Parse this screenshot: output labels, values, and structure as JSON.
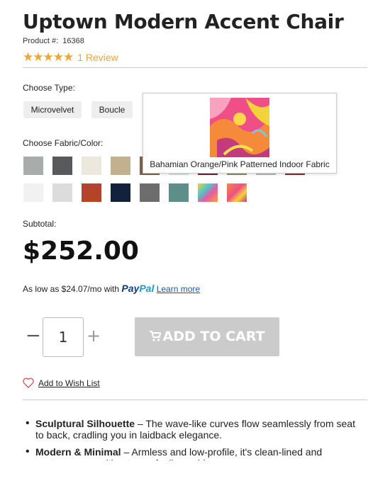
{
  "product": {
    "title": "Uptown Modern Accent Chair",
    "product_number_label": "Product #:",
    "product_number": "16368",
    "stars": "★★★★★",
    "review_text": "1 Review"
  },
  "type": {
    "label": "Choose Type:",
    "options": [
      "Microvelvet",
      "Boucle"
    ]
  },
  "fabric": {
    "label": "Choose Fabric/Color:",
    "row1_colors": [
      "#a8adab",
      "#58595b",
      "#ece8de",
      "#c2b08e",
      "#7a6252",
      "#d6e1e2",
      "#6d2233",
      "#8a8a6e",
      "#b9b8b6",
      "#8e2b2e"
    ],
    "row2_colors": [
      "#f1f1f1",
      "#dcdcdc",
      "#b5432a",
      "#13213a",
      "#6d6d6d",
      "#5e8e8a"
    ],
    "tooltip_label": "Bahamian Orange/Pink Patterned Indoor Fabric",
    "selected_index": 8
  },
  "subtotal": {
    "label": "Subtotal:",
    "price": "$252.00"
  },
  "paypal": {
    "text": "As low as $24.07/mo with",
    "brand_pay": "Pay",
    "brand_pal": "Pal",
    "learn_more": "Learn more"
  },
  "cart": {
    "minus": "−",
    "quantity": "1",
    "plus": "+",
    "button_label": "ADD TO CART"
  },
  "wishlist": {
    "label": "Add to Wish List"
  },
  "features": [
    {
      "title": "Sculptural Silhouette",
      "text": " – The wave-like curves flow seamlessly from seat to back, cradling you in laidback elegance."
    },
    {
      "title": "Modern & Minimal",
      "text": " – Armless and low-profile, it's clean-lined and contemporary without ever feeling cold."
    }
  ]
}
